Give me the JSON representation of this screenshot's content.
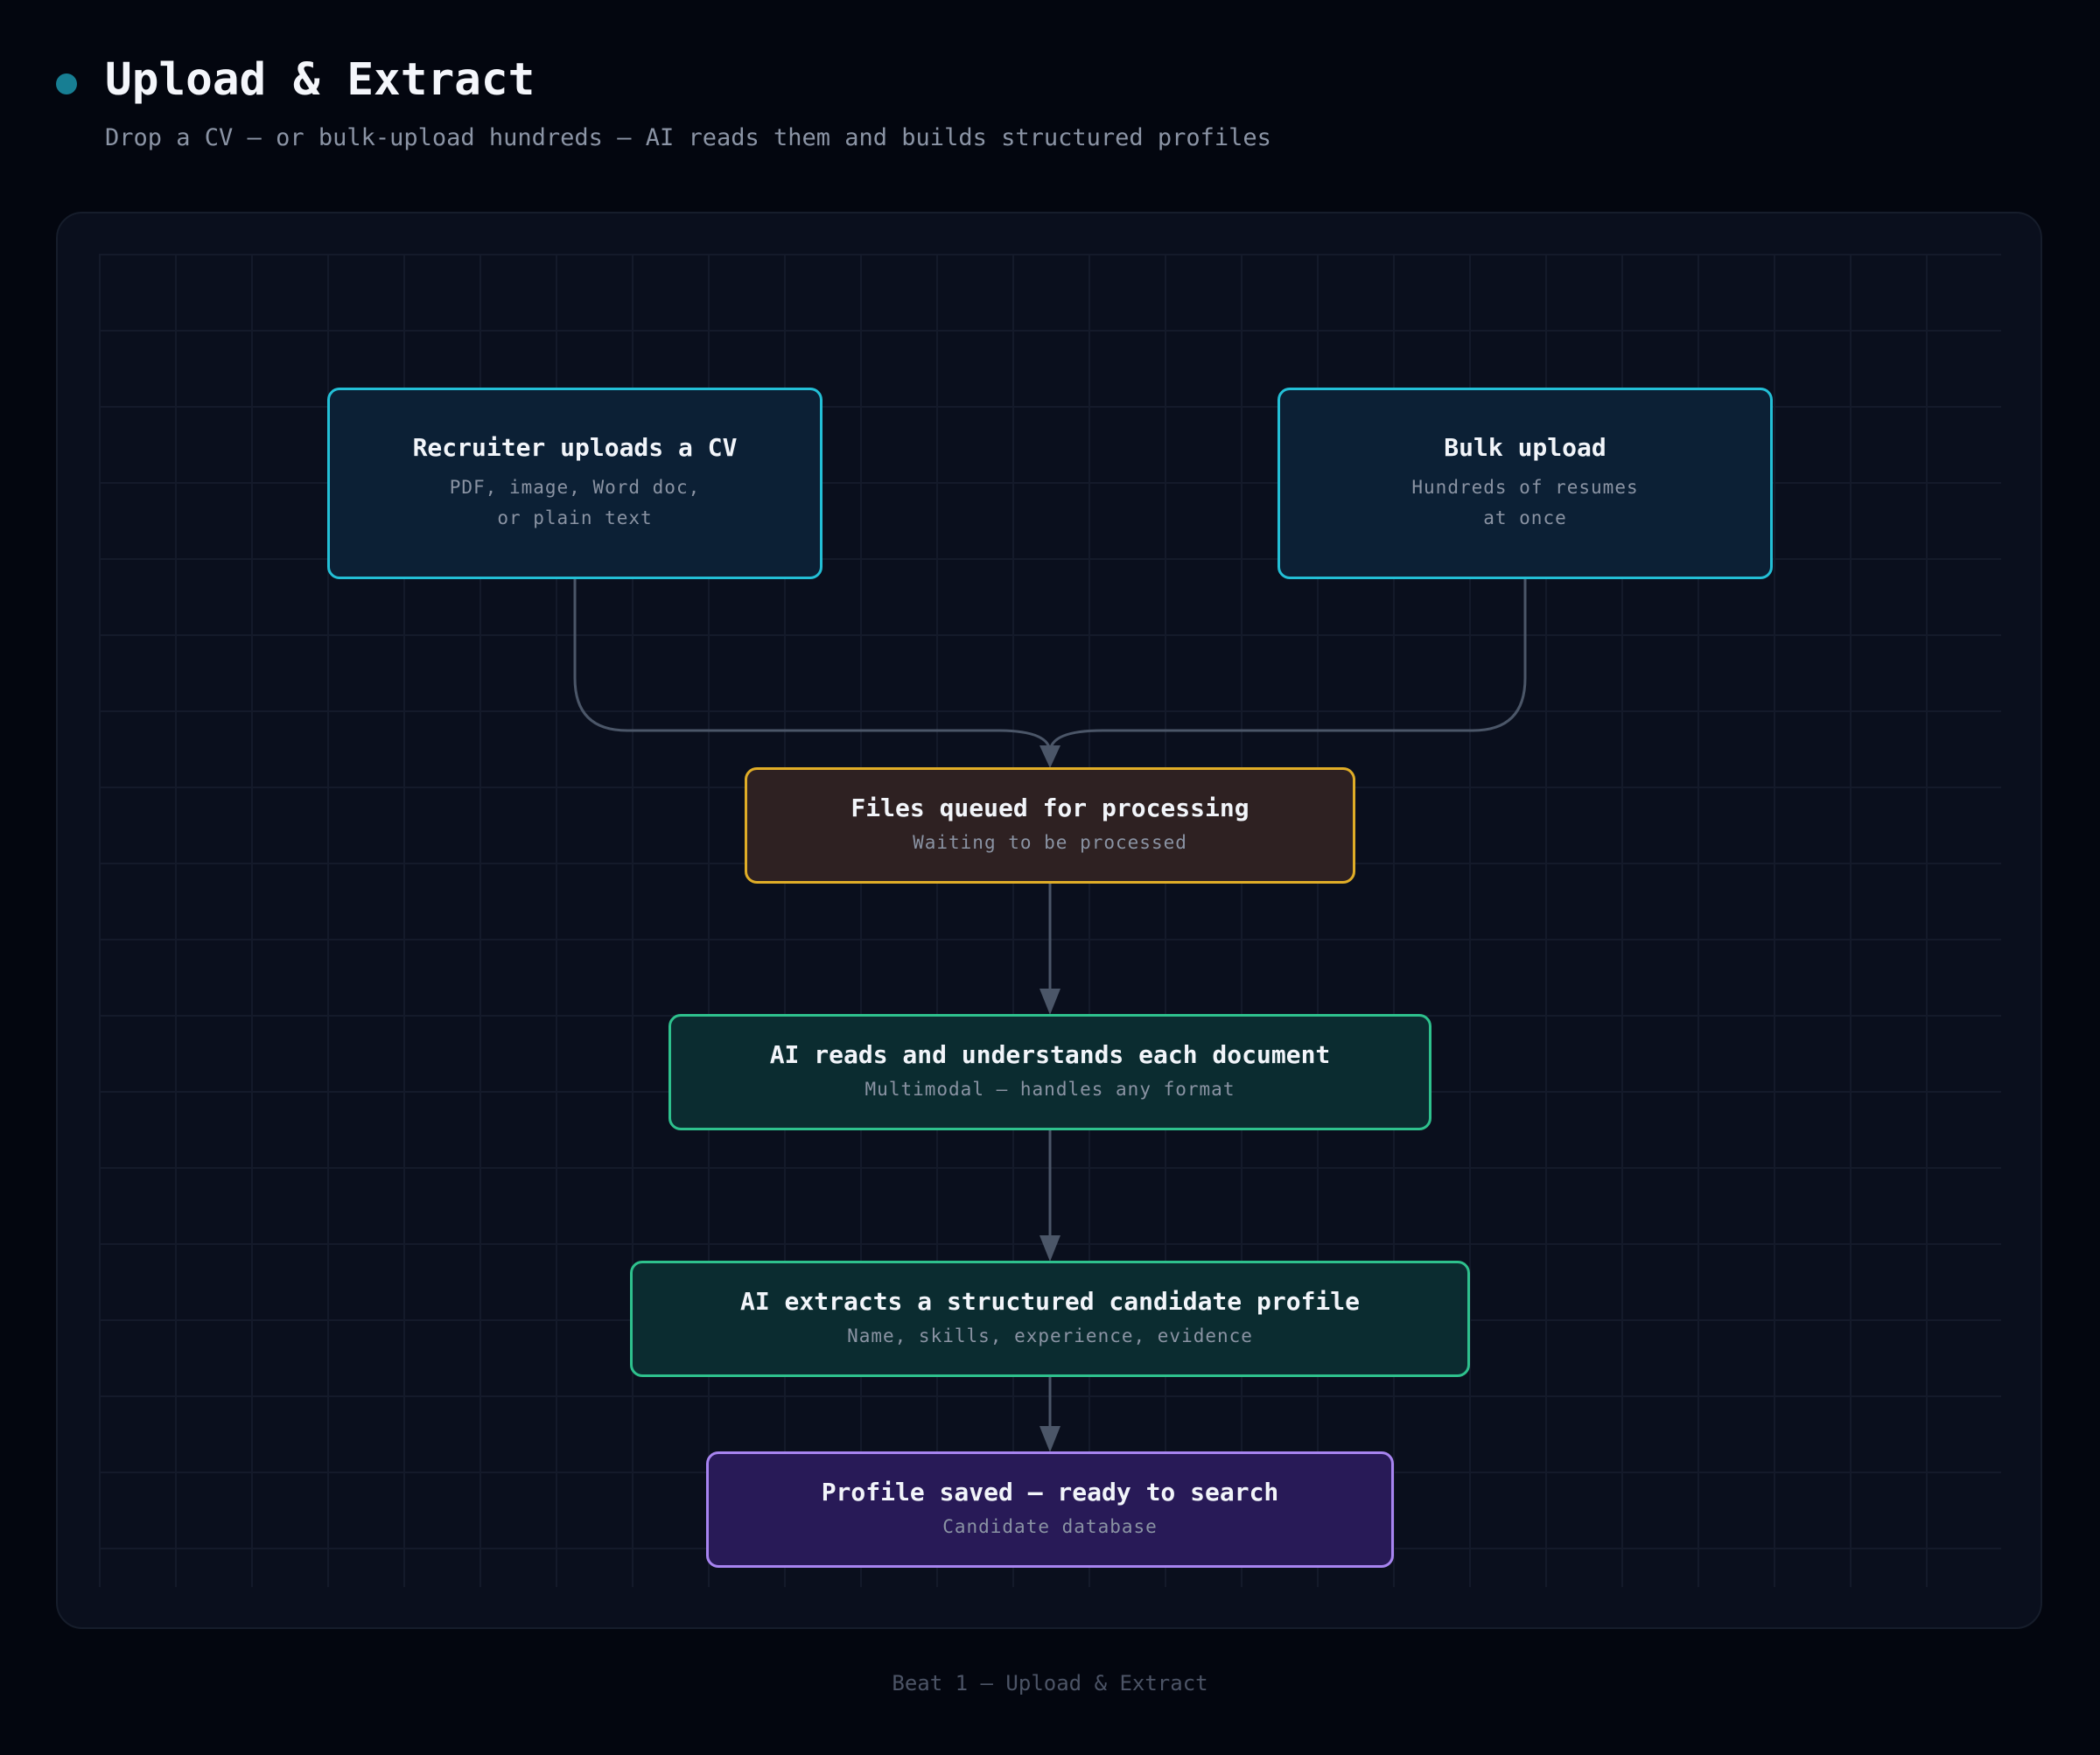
{
  "header": {
    "title": "Upload & Extract",
    "subtitle": "Drop a CV — or bulk-upload hundreds — AI reads them and builds structured profiles"
  },
  "nodes": {
    "upload_cv": {
      "title": "Recruiter uploads a CV",
      "line1": "PDF, image, Word doc,",
      "line2": "or plain text"
    },
    "bulk_upload": {
      "title": "Bulk upload",
      "line1": "Hundreds of resumes",
      "line2": "at once"
    },
    "queued": {
      "title": "Files queued for processing",
      "subtitle": "Waiting to be processed"
    },
    "ai_reads": {
      "title": "AI reads and understands each document",
      "subtitle": "Multimodal — handles any format"
    },
    "ai_extracts": {
      "title": "AI extracts a structured candidate profile",
      "subtitle": "Name, skills, experience, evidence"
    },
    "saved": {
      "title": "Profile saved — ready to search",
      "subtitle": "Candidate database"
    }
  },
  "footer": {
    "caption": "Beat 1 — Upload & Extract"
  },
  "colors": {
    "background": "#03060f",
    "panel": "#0a0f1d",
    "accent_dot": "#177e93",
    "cyan": "#23bfd6",
    "amber": "#e0ad27",
    "green": "#2ec18d",
    "purple": "#a784f0",
    "connector": "#4b5668"
  }
}
